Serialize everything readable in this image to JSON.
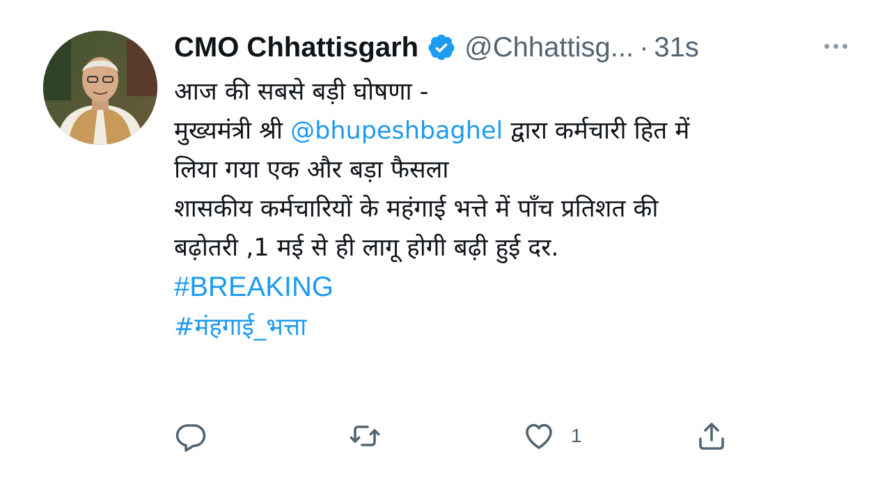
{
  "author": {
    "name": "CMO Chhattisgarh",
    "handle": "@Chhattisg...",
    "separator": "·",
    "time": "31s",
    "verified": true,
    "avatar_alt": "profile-photo"
  },
  "tweet": {
    "line1": "आज की सबसे बड़ी घोषणा -",
    "line2_pre": "मुख्यमंत्री श्री ",
    "line2_mention": "@bhupeshbaghel",
    "line2_post": " द्वारा कर्मचारी हित में",
    "line3": "लिया गया एक और बड़ा फैसला",
    "line4": "शासकीय कर्मचारियों के महंगाई भत्ते में पाँच प्रतिशत की",
    "line5": "बढ़ोतरी ,1 मई से ही लागू होगी बढ़ी हुई दर.",
    "hashtags": [
      "#BREAKING",
      "#मंहगाई_भत्ता"
    ]
  },
  "actions": {
    "reply_count": "",
    "retweet_count": "",
    "like_count": "1",
    "share_count": ""
  },
  "colors": {
    "link": "#1d9bf0",
    "muted": "#536471",
    "text": "#0f1419",
    "verified": "#1d9bf0"
  },
  "icons": [
    "verified-badge-icon",
    "more-icon",
    "reply-icon",
    "retweet-icon",
    "like-icon",
    "share-icon"
  ]
}
